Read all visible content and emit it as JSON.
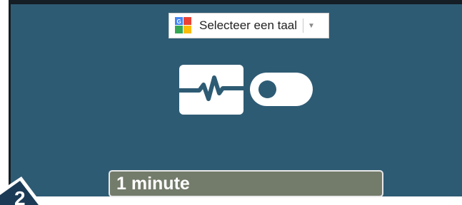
{
  "language_selector": {
    "label": "Selecteer een taal",
    "caret_glyph": "▼",
    "icon": "google-translate-icon"
  },
  "activity_icon": "heartbeat-icon",
  "toggle": {
    "state": "off"
  },
  "duration": {
    "value": "1 minute"
  },
  "corner_badge": {
    "text": "2"
  },
  "colors": {
    "panel_bg": "#2e5b74",
    "field_bg": "#737b6a",
    "frame_border": "#151d25"
  }
}
